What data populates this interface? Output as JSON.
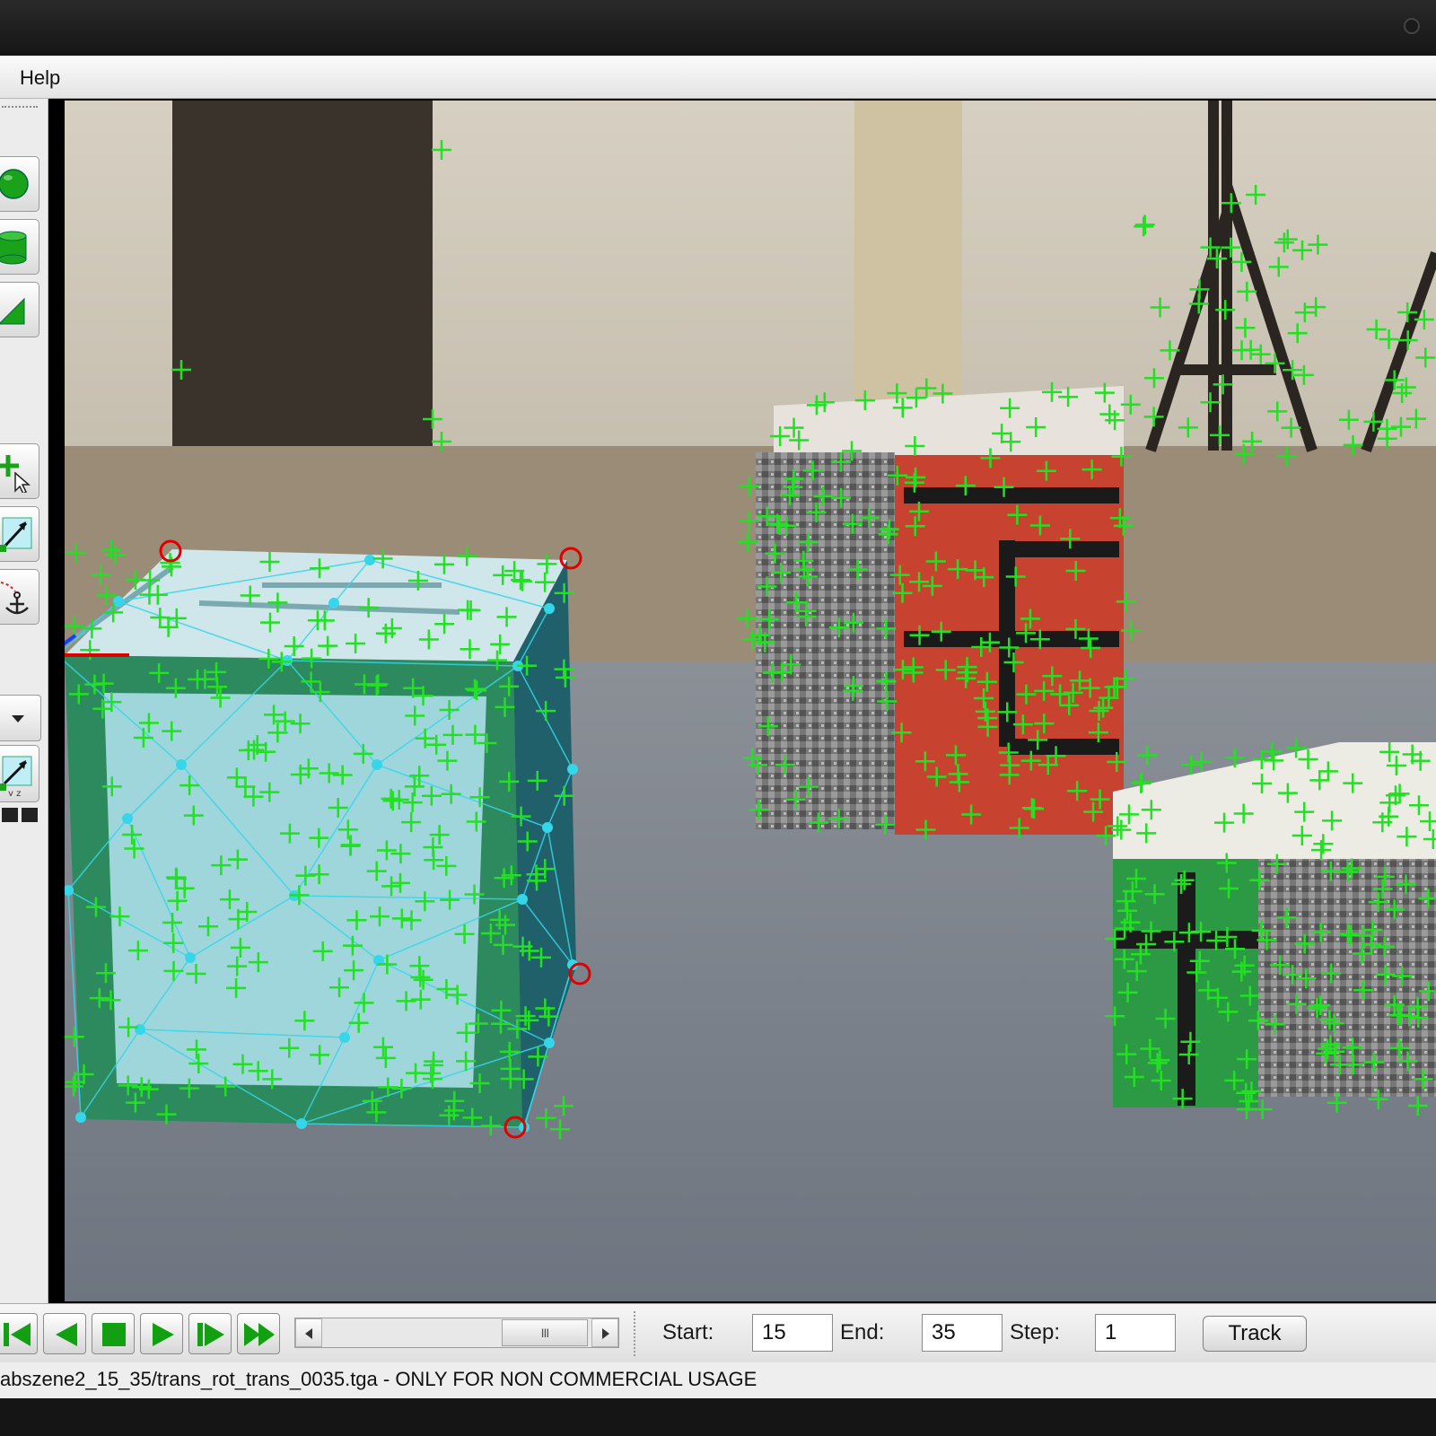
{
  "menu": {
    "help_label": "Help"
  },
  "toolbar": {
    "tools": [
      "sphere-icon",
      "cylinder-icon",
      "wedge-icon",
      "add-point-cursor-icon",
      "vector-arrow-icon",
      "anchor-icon",
      "axis-arrow-icon"
    ]
  },
  "playback": {
    "buttons": [
      "skip-to-start-icon",
      "step-back-icon",
      "stop-icon",
      "play-icon",
      "step-forward-icon",
      "fast-forward-icon"
    ],
    "scroll_thumb_label": "III"
  },
  "tracking": {
    "start_label": "Start:",
    "start_value": "15",
    "end_label": "End:",
    "end_value": "35",
    "step_label": "Step:",
    "step_value": "1",
    "track_button": "Track"
  },
  "status": {
    "text": "abszene2_15_35/trans_rot_trans_0035.tga - ONLY FOR NON COMMERCIAL USAGE"
  },
  "colors": {
    "feature_marker": "#22e022",
    "mesh": "#35d6ea",
    "constraint_marker": "#e00000"
  }
}
